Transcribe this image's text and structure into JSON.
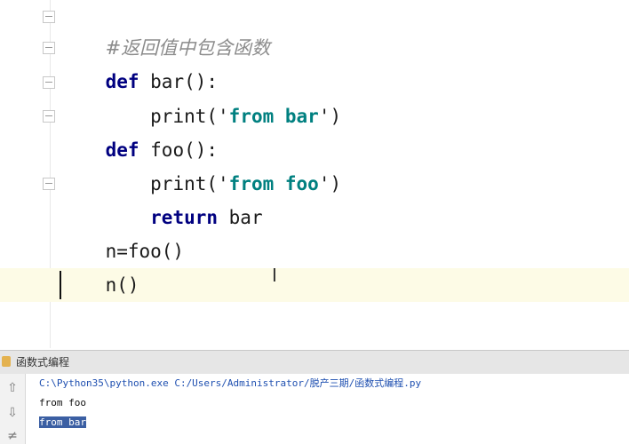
{
  "editor": {
    "lines": [
      {
        "type": "comment",
        "text": "#返回值中包含函数"
      },
      {
        "kw": "def",
        "rest": " bar():"
      },
      {
        "indent": "    ",
        "pre": "print('",
        "str": "from bar",
        "post": "')"
      },
      {
        "kw": "def",
        "rest": " foo():"
      },
      {
        "indent": "    ",
        "pre": "print('",
        "str": "from foo",
        "post": "')"
      },
      {
        "indent": "    ",
        "kw": "return",
        "rest": " bar"
      },
      {
        "text": "n=foo()"
      },
      {
        "text": "n()"
      }
    ]
  },
  "run_panel": {
    "title": "函数式编程",
    "command": "C:\\Python35\\python.exe C:/Users/Administrator/脱产三期/函数式编程.py",
    "output": [
      "from foo",
      "from bar"
    ]
  },
  "icons": {
    "up": "arrow-up-icon",
    "down": "arrow-down-icon",
    "wrap": "soft-wrap-icon"
  }
}
